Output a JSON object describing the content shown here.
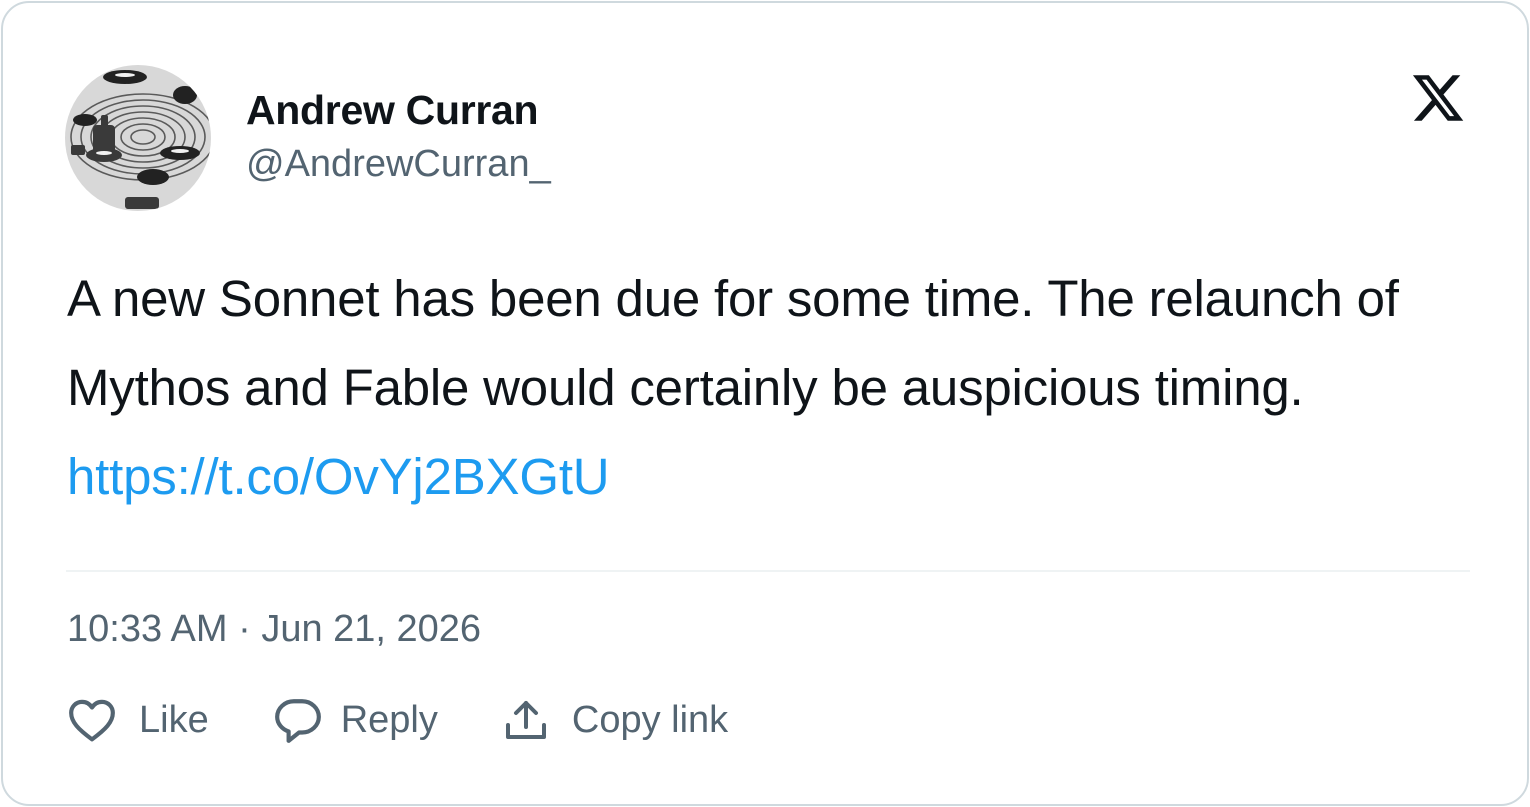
{
  "author": {
    "display_name": "Andrew Curran",
    "handle": "@AndrewCurran_",
    "avatar": "avatar-image"
  },
  "brand": {
    "logo_icon": "x-logo-icon"
  },
  "tweet": {
    "text": "A new Sonnet has been due for some time. The relaunch of Mythos and Fable would certainly be auspicious timing.",
    "link": "https://t.co/OvYj2BXGtU",
    "timestamp": "10:33 AM · Jun 21, 2026"
  },
  "actions": {
    "like_label": "Like",
    "like_icon": "heart-icon",
    "reply_label": "Reply",
    "reply_icon": "speech-bubble-icon",
    "copy_label": "Copy link",
    "copy_icon": "share-upload-icon"
  },
  "colors": {
    "text_primary": "#0f1419",
    "text_secondary": "#536471",
    "link": "#1d9bf0",
    "border": "#cfd9de",
    "divider": "#eff3f4"
  }
}
